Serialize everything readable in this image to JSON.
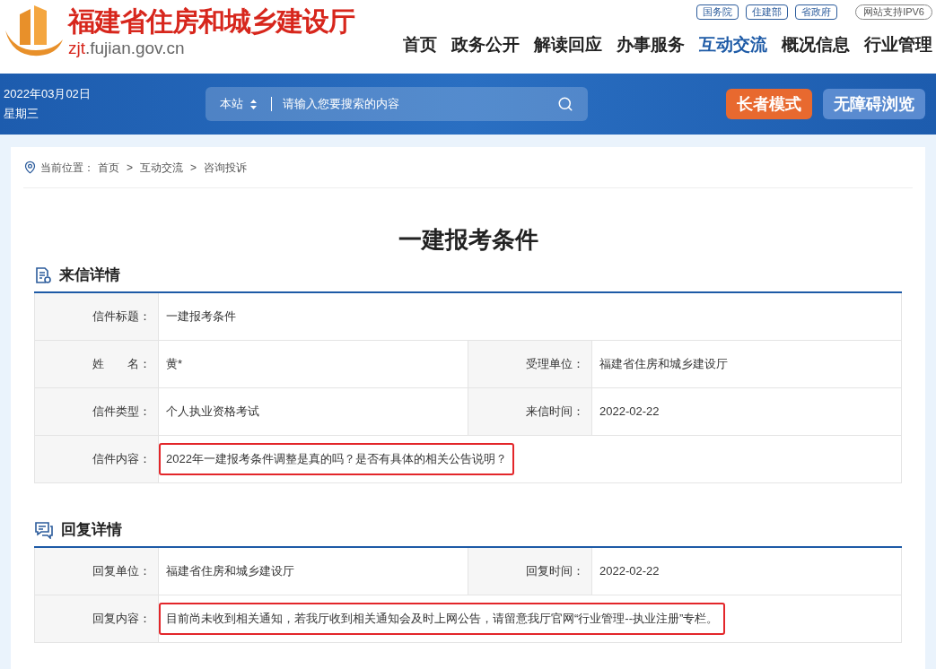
{
  "header": {
    "logo": {
      "title": "福建省住房和城乡建设厅",
      "domain_prefix": "zjt",
      "domain_rest": ".fujian.gov.cn"
    },
    "top_links": [
      "国务院",
      "住建部",
      "省政府"
    ],
    "ipv6": "网站支持IPV6",
    "nav": [
      {
        "label": "首页",
        "selected": false
      },
      {
        "label": "政务公开",
        "selected": false
      },
      {
        "label": "解读回应",
        "selected": false
      },
      {
        "label": "办事服务",
        "selected": false
      },
      {
        "label": "互动交流",
        "selected": true
      },
      {
        "label": "概况信息",
        "selected": false
      },
      {
        "label": "行业管理",
        "selected": false
      }
    ]
  },
  "banner": {
    "date": "2022年03月02日",
    "weekday": "星期三",
    "search": {
      "scope": "本站",
      "placeholder": "请输入您要搜索的内容"
    },
    "buttons": [
      {
        "label": "长者模式",
        "kind": "elder"
      },
      {
        "label": "无障碍浏览",
        "kind": "accessible"
      }
    ]
  },
  "breadcrumb": {
    "label": "当前位置：",
    "separator": ">",
    "items": [
      "首页",
      "互动交流",
      "咨询投诉"
    ]
  },
  "title": "一建报考条件",
  "sections": [
    {
      "title": "来信详情",
      "kind": "letter",
      "rows": [
        {
          "cells": [
            {
              "label": "信件标题：",
              "value": "一建报考条件",
              "highlighted": false
            }
          ]
        },
        {
          "cells": [
            {
              "label": "姓　　名：",
              "value": "黄*",
              "highlighted": false
            },
            {
              "label": "受理单位：",
              "value": "福建省住房和城乡建设厅",
              "highlighted": false
            }
          ]
        },
        {
          "cells": [
            {
              "label": "信件类型：",
              "value": "个人执业资格考试",
              "highlighted": false
            },
            {
              "label": "来信时间：",
              "value": "2022-02-22",
              "highlighted": false
            }
          ]
        },
        {
          "cells": [
            {
              "label": "信件内容：",
              "value": "2022年一建报考条件调整是真的吗？是否有具体的相关公告说明？",
              "highlighted": true
            }
          ]
        }
      ]
    },
    {
      "title": "回复详情",
      "kind": "reply",
      "rows": [
        {
          "cells": [
            {
              "label": "回复单位：",
              "value": "福建省住房和城乡建设厅",
              "highlighted": false
            },
            {
              "label": "回复时间：",
              "value": "2022-02-22",
              "highlighted": false
            }
          ]
        },
        {
          "cells": [
            {
              "label": "回复内容：",
              "value": "目前尚未收到相关通知，若我厅收到相关通知会及时上网公告，请留意我厅官网“行业管理--执业注册”专栏。",
              "highlighted": true
            }
          ]
        }
      ]
    }
  ]
}
